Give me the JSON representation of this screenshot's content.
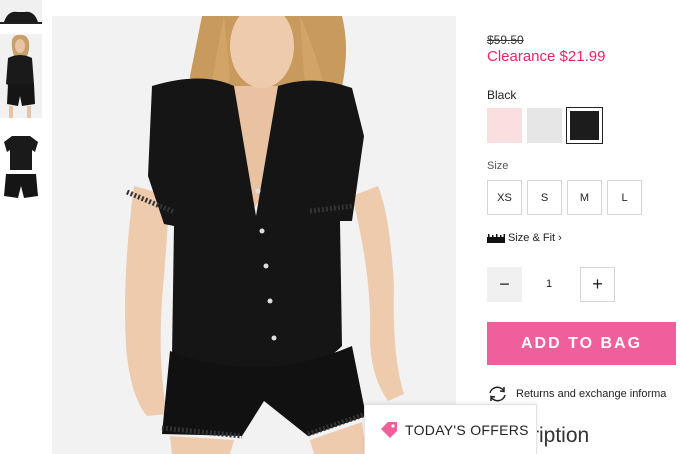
{
  "product": {
    "original_price": "$59.50",
    "clearance_price": "Clearance $21.99",
    "selected_color": "Black",
    "colors": [
      {
        "name": "pink",
        "hex": "#f9dfe0",
        "selected": false
      },
      {
        "name": "gray",
        "hex": "#e6e6e6",
        "selected": false
      },
      {
        "name": "black",
        "hex": "#1c1c1c",
        "selected": true
      }
    ],
    "size_label": "Size",
    "sizes": [
      "XS",
      "S",
      "M",
      "L"
    ],
    "size_fit_label": "Size & Fit",
    "quantity": "1",
    "minus_symbol": "−",
    "plus_symbol": "+",
    "add_to_bag_label": "ADD TO BAG",
    "returns_text": "Returns and exchange informa",
    "description_heading": "ription"
  },
  "offers": {
    "label": "TODAY'S OFFERS"
  },
  "icons": {
    "ruler": "ruler-icon",
    "chevron": "chevron-right-icon",
    "returns": "refresh-arrows-icon",
    "tag": "price-tag-icon"
  },
  "colors": {
    "accent_pink": "#ef5f9c",
    "clearance_red": "#e3266c"
  }
}
